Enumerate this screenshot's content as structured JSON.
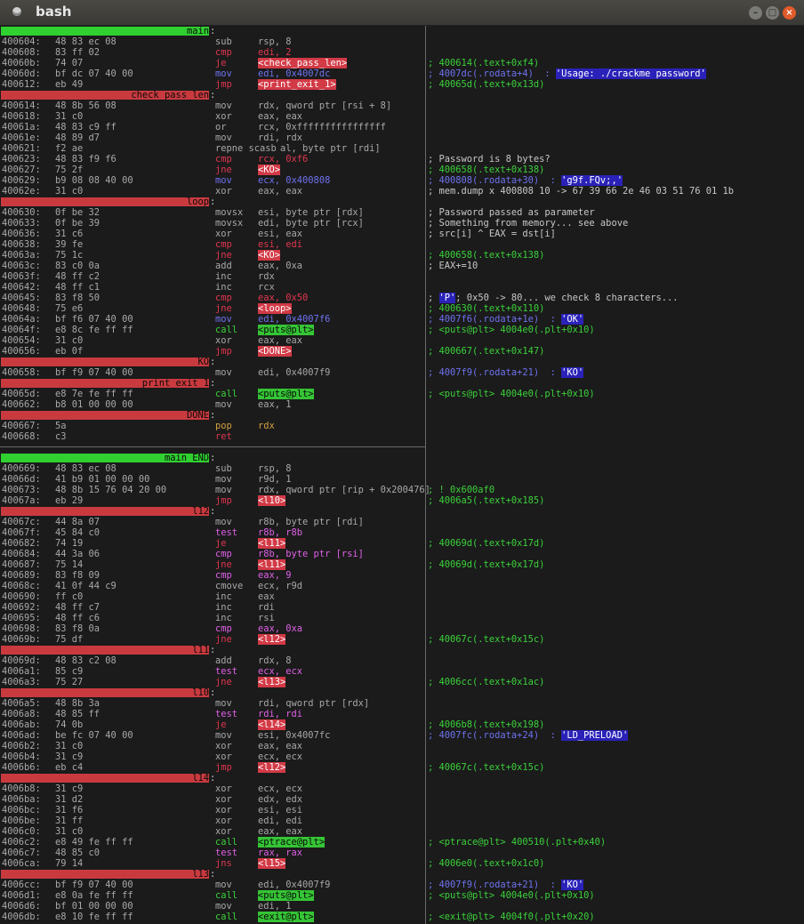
{
  "window": {
    "title": "bash"
  },
  "colors": {
    "label_red": "#c93a3f",
    "label_green": "#2fd030",
    "comment_green": "#3ad13a",
    "string_blue": "#2a22b8"
  },
  "lines": [
    {
      "kind": "label",
      "text": "main",
      "style": "grn"
    },
    {
      "kind": "ins",
      "addr": "400604:",
      "bytes": "48 83 ec 08",
      "mn": "sub",
      "op": "rsp, 8",
      "cm": ""
    },
    {
      "kind": "ins",
      "addr": "400608:",
      "bytes": "83 ff 02",
      "mn": "cmp",
      "op": "edi, 2",
      "mnc": "red",
      "opc": "red",
      "cm": ""
    },
    {
      "kind": "ins",
      "addr": "40060b:",
      "bytes": "74 07",
      "mn": "je",
      "op": "<check_pass_len>",
      "mnc": "red",
      "optag": "red",
      "cm": "; 400614(.text+0xf4)",
      "cmc": "grn"
    },
    {
      "kind": "ins",
      "addr": "40060d:",
      "bytes": "bf dc 07 40 00",
      "mn": "mov",
      "op": "edi, 0x4007dc",
      "mnc": "blu",
      "opc": "blu",
      "cm": "; 4007dc(.rodata+4)  : ",
      "cmc": "blu",
      "cmtag": "'Usage: ./crackme password'"
    },
    {
      "kind": "ins",
      "addr": "400612:",
      "bytes": "eb 49",
      "mn": "jmp",
      "op": "<print_exit_1>",
      "mnc": "red",
      "optag": "red",
      "cm": "; 40065d(.text+0x13d)",
      "cmc": "grn"
    },
    {
      "kind": "label",
      "text": "check_pass_len",
      "style": "red"
    },
    {
      "kind": "ins",
      "addr": "400614:",
      "bytes": "48 8b 56 08",
      "mn": "mov",
      "op": "rdx, qword ptr [rsi + 8]",
      "cm": ""
    },
    {
      "kind": "ins",
      "addr": "400618:",
      "bytes": "31 c0",
      "mn": "xor",
      "op": "eax, eax",
      "cm": ""
    },
    {
      "kind": "ins",
      "addr": "40061a:",
      "bytes": "48 83 c9 ff",
      "mn": "or",
      "op": "rcx, 0xffffffffffffffff",
      "cm": ""
    },
    {
      "kind": "ins",
      "addr": "40061e:",
      "bytes": "48 89 d7",
      "mn": "mov",
      "op": "rdi, rdx",
      "cm": ""
    },
    {
      "kind": "ins",
      "addr": "400621:",
      "bytes": "f2 ae",
      "mn": "repne scasb",
      "op": "    al, byte ptr [rdi]",
      "cm": ""
    },
    {
      "kind": "ins",
      "addr": "400623:",
      "bytes": "48 83 f9 f6",
      "mn": "cmp",
      "op": "rcx, 0xf6",
      "mnc": "red",
      "opc": "red",
      "cm": "; Password is 8 bytes?",
      "cmc": "wht"
    },
    {
      "kind": "ins",
      "addr": "400627:",
      "bytes": "75 2f",
      "mn": "jne",
      "op": "<KO>",
      "mnc": "red",
      "optag": "red",
      "cm": "; 400658(.text+0x138)",
      "cmc": "grn"
    },
    {
      "kind": "ins",
      "addr": "400629:",
      "bytes": "b9 08 08 40 00",
      "mn": "mov",
      "op": "ecx, 0x400808",
      "mnc": "blu",
      "opc": "blu",
      "cm": "; 400808(.rodata+30)  : ",
      "cmc": "blu",
      "cmtag": "'g9f.FQv;,'"
    },
    {
      "kind": "ins",
      "addr": "40062e:",
      "bytes": "31 c0",
      "mn": "xor",
      "op": "eax, eax",
      "cm": "; mem.dump x 400808 10 -> 67 39 66 2e 46 03 51 76 01 1b",
      "cmc": "wht"
    },
    {
      "kind": "label",
      "text": "loop",
      "style": "red"
    },
    {
      "kind": "ins",
      "addr": "400630:",
      "bytes": "0f be 32",
      "mn": "movsx",
      "op": "esi, byte ptr [rdx]",
      "cm": "; Password passed as parameter",
      "cmc": "wht"
    },
    {
      "kind": "ins",
      "addr": "400633:",
      "bytes": "0f be 39",
      "mn": "movsx",
      "op": "edi, byte ptr [rcx]",
      "cm": "; Something from memory... see above",
      "cmc": "wht"
    },
    {
      "kind": "ins",
      "addr": "400636:",
      "bytes": "31 c6",
      "mn": "xor",
      "op": "esi, eax",
      "cm": "; src[i] ^ EAX = dst[i]",
      "cmc": "wht"
    },
    {
      "kind": "ins",
      "addr": "400638:",
      "bytes": "39 fe",
      "mn": "cmp",
      "op": "esi, edi",
      "mnc": "red",
      "opc": "red",
      "cm": ""
    },
    {
      "kind": "ins",
      "addr": "40063a:",
      "bytes": "75 1c",
      "mn": "jne",
      "op": "<KO>",
      "mnc": "red",
      "optag": "red",
      "cm": "; 400658(.text+0x138)",
      "cmc": "grn"
    },
    {
      "kind": "ins",
      "addr": "40063c:",
      "bytes": "83 c0 0a",
      "mn": "add",
      "op": "eax, 0xa",
      "cm": "; EAX+=10",
      "cmc": "wht"
    },
    {
      "kind": "ins",
      "addr": "40063f:",
      "bytes": "48 ff c2",
      "mn": "inc",
      "op": "rdx",
      "cm": ""
    },
    {
      "kind": "ins",
      "addr": "400642:",
      "bytes": "48 ff c1",
      "mn": "inc",
      "op": "rcx",
      "cm": ""
    },
    {
      "kind": "ins",
      "addr": "400645:",
      "bytes": "83 f8 50",
      "mn": "cmp",
      "op": "eax, 0x50",
      "mnc": "red",
      "opc": "red",
      "cm": "; ",
      "cmc": "wht",
      "cmtag2": "'P'",
      "cmrest": "; 0x50 -> 80... we check 8 characters..."
    },
    {
      "kind": "ins",
      "addr": "400648:",
      "bytes": "75 e6",
      "mn": "jne",
      "op": "<loop>",
      "mnc": "red",
      "optag": "red",
      "cm": "; 400630(.text+0x110)",
      "cmc": "grn"
    },
    {
      "kind": "ins",
      "addr": "40064a:",
      "bytes": "bf f6 07 40 00",
      "mn": "mov",
      "op": "edi, 0x4007f6",
      "mnc": "blu",
      "opc": "blu",
      "cm": "; 4007f6(.rodata+1e)  : ",
      "cmc": "blu",
      "cmtag": "'OK'"
    },
    {
      "kind": "ins",
      "addr": "40064f:",
      "bytes": "e8 8c fe ff ff",
      "mn": "call",
      "op": "<puts@plt>",
      "mnc": "grn",
      "optag": "grn",
      "cm": "; <puts@plt> 4004e0(.plt+0x10)",
      "cmc": "grn"
    },
    {
      "kind": "ins",
      "addr": "400654:",
      "bytes": "31 c0",
      "mn": "xor",
      "op": "eax, eax",
      "cm": ""
    },
    {
      "kind": "ins",
      "addr": "400656:",
      "bytes": "eb 0f",
      "mn": "jmp",
      "op": "<DONE>",
      "mnc": "red",
      "optag": "red",
      "cm": "; 400667(.text+0x147)",
      "cmc": "grn"
    },
    {
      "kind": "label",
      "text": "KO",
      "style": "red"
    },
    {
      "kind": "ins",
      "addr": "400658:",
      "bytes": "bf f9 07 40 00",
      "mn": "mov",
      "op": "edi, 0x4007f9",
      "cm": "; 4007f9(.rodata+21)  : ",
      "cmc": "blu",
      "cmtag": "'KO'"
    },
    {
      "kind": "label",
      "text": "print_exit_1",
      "style": "red"
    },
    {
      "kind": "ins",
      "addr": "40065d:",
      "bytes": "e8 7e fe ff ff",
      "mn": "call",
      "op": "<puts@plt>",
      "mnc": "grn",
      "optag": "grn",
      "cm": "; <puts@plt> 4004e0(.plt+0x10)",
      "cmc": "grn"
    },
    {
      "kind": "ins",
      "addr": "400662:",
      "bytes": "b8 01 00 00 00",
      "mn": "mov",
      "op": "eax, 1",
      "cm": ""
    },
    {
      "kind": "label",
      "text": "DONE",
      "style": "red"
    },
    {
      "kind": "ins",
      "addr": "400667:",
      "bytes": "5a",
      "mn": "pop",
      "op": "rdx",
      "mnc": "yel",
      "opc": "yel",
      "cm": ""
    },
    {
      "kind": "ins",
      "addr": "400668:",
      "bytes": "c3",
      "mn": "ret",
      "op": "",
      "mnc": "red",
      "cm": ""
    },
    {
      "kind": "blank"
    },
    {
      "kind": "label",
      "text": "main_END",
      "style": "grn"
    },
    {
      "kind": "ins",
      "addr": "400669:",
      "bytes": "48 83 ec 08",
      "mn": "sub",
      "op": "rsp, 8",
      "cm": ""
    },
    {
      "kind": "ins",
      "addr": "40066d:",
      "bytes": "41 b9 01 00 00 00",
      "mn": "mov",
      "op": "r9d, 1",
      "cm": ""
    },
    {
      "kind": "ins",
      "addr": "400673:",
      "bytes": "48 8b 15 76 04 20 00",
      "mn": "mov",
      "op": "rdx, qword ptr [rip + 0x200476]",
      "cm": "; ! 0x600af0",
      "cmc": "grn"
    },
    {
      "kind": "ins",
      "addr": "40067a:",
      "bytes": "eb 29",
      "mn": "jmp",
      "op": "<l10>",
      "mnc": "red",
      "optag": "red",
      "cm": "; 4006a5(.text+0x185)",
      "cmc": "grn"
    },
    {
      "kind": "label",
      "text": "l12",
      "style": "red"
    },
    {
      "kind": "ins",
      "addr": "40067c:",
      "bytes": "44 8a 07",
      "mn": "mov",
      "op": "r8b, byte ptr [rdi]",
      "cm": ""
    },
    {
      "kind": "ins",
      "addr": "40067f:",
      "bytes": "45 84 c0",
      "mn": "test",
      "op": "r8b, r8b",
      "mnc": "mag",
      "opc": "mag",
      "cm": ""
    },
    {
      "kind": "ins",
      "addr": "400682:",
      "bytes": "74 19",
      "mn": "je",
      "op": "<l11>",
      "mnc": "red",
      "optag": "red",
      "cm": "; 40069d(.text+0x17d)",
      "cmc": "grn"
    },
    {
      "kind": "ins",
      "addr": "400684:",
      "bytes": "44 3a 06",
      "mn": "cmp",
      "op": "r8b, byte ptr [rsi]",
      "mnc": "mag",
      "opc": "mag",
      "cm": ""
    },
    {
      "kind": "ins",
      "addr": "400687:",
      "bytes": "75 14",
      "mn": "jne",
      "op": "<l11>",
      "mnc": "red",
      "optag": "red",
      "cm": "; 40069d(.text+0x17d)",
      "cmc": "grn"
    },
    {
      "kind": "ins",
      "addr": "400689:",
      "bytes": "83 f8 09",
      "mn": "cmp",
      "op": "eax, 9",
      "mnc": "mag",
      "opc": "mag",
      "cm": ""
    },
    {
      "kind": "ins",
      "addr": "40068c:",
      "bytes": "41 0f 44 c9",
      "mn": "cmove",
      "op": "ecx, r9d",
      "cm": ""
    },
    {
      "kind": "ins",
      "addr": "400690:",
      "bytes": "ff c0",
      "mn": "inc",
      "op": "eax",
      "cm": ""
    },
    {
      "kind": "ins",
      "addr": "400692:",
      "bytes": "48 ff c7",
      "mn": "inc",
      "op": "rdi",
      "cm": ""
    },
    {
      "kind": "ins",
      "addr": "400695:",
      "bytes": "48 ff c6",
      "mn": "inc",
      "op": "rsi",
      "cm": ""
    },
    {
      "kind": "ins",
      "addr": "400698:",
      "bytes": "83 f8 0a",
      "mn": "cmp",
      "op": "eax, 0xa",
      "mnc": "mag",
      "opc": "mag",
      "cm": ""
    },
    {
      "kind": "ins",
      "addr": "40069b:",
      "bytes": "75 df",
      "mn": "jne",
      "op": "<l12>",
      "mnc": "red",
      "optag": "red",
      "cm": "; 40067c(.text+0x15c)",
      "cmc": "grn"
    },
    {
      "kind": "label",
      "text": "l11",
      "style": "red"
    },
    {
      "kind": "ins",
      "addr": "40069d:",
      "bytes": "48 83 c2 08",
      "mn": "add",
      "op": "rdx, 8",
      "cm": ""
    },
    {
      "kind": "ins",
      "addr": "4006a1:",
      "bytes": "85 c9",
      "mn": "test",
      "op": "ecx, ecx",
      "mnc": "mag",
      "opc": "mag",
      "cm": ""
    },
    {
      "kind": "ins",
      "addr": "4006a3:",
      "bytes": "75 27",
      "mn": "jne",
      "op": "<l13>",
      "mnc": "red",
      "optag": "red",
      "cm": "; 4006cc(.text+0x1ac)",
      "cmc": "grn"
    },
    {
      "kind": "label",
      "text": "l10",
      "style": "red"
    },
    {
      "kind": "ins",
      "addr": "4006a5:",
      "bytes": "48 8b 3a",
      "mn": "mov",
      "op": "rdi, qword ptr [rdx]",
      "cm": ""
    },
    {
      "kind": "ins",
      "addr": "4006a8:",
      "bytes": "48 85 ff",
      "mn": "test",
      "op": "rdi, rdi",
      "mnc": "mag",
      "opc": "mag",
      "cm": ""
    },
    {
      "kind": "ins",
      "addr": "4006ab:",
      "bytes": "74 0b",
      "mn": "je",
      "op": "<l14>",
      "mnc": "red",
      "optag": "red",
      "cm": "; 4006b8(.text+0x198)",
      "cmc": "grn"
    },
    {
      "kind": "ins",
      "addr": "4006ad:",
      "bytes": "be fc 07 40 00",
      "mn": "mov",
      "op": "esi, 0x4007fc",
      "cm": "; 4007fc(.rodata+24)  : ",
      "cmc": "blu",
      "cmtag": "'LD_PRELOAD'"
    },
    {
      "kind": "ins",
      "addr": "4006b2:",
      "bytes": "31 c0",
      "mn": "xor",
      "op": "eax, eax",
      "cm": ""
    },
    {
      "kind": "ins",
      "addr": "4006b4:",
      "bytes": "31 c9",
      "mn": "xor",
      "op": "ecx, ecx",
      "cm": ""
    },
    {
      "kind": "ins",
      "addr": "4006b6:",
      "bytes": "eb c4",
      "mn": "jmp",
      "op": "<l12>",
      "mnc": "red",
      "optag": "red",
      "cm": "; 40067c(.text+0x15c)",
      "cmc": "grn"
    },
    {
      "kind": "label",
      "text": "l14",
      "style": "red"
    },
    {
      "kind": "ins",
      "addr": "4006b8:",
      "bytes": "31 c9",
      "mn": "xor",
      "op": "ecx, ecx",
      "cm": ""
    },
    {
      "kind": "ins",
      "addr": "4006ba:",
      "bytes": "31 d2",
      "mn": "xor",
      "op": "edx, edx",
      "cm": ""
    },
    {
      "kind": "ins",
      "addr": "4006bc:",
      "bytes": "31 f6",
      "mn": "xor",
      "op": "esi, esi",
      "cm": ""
    },
    {
      "kind": "ins",
      "addr": "4006be:",
      "bytes": "31 ff",
      "mn": "xor",
      "op": "edi, edi",
      "cm": ""
    },
    {
      "kind": "ins",
      "addr": "4006c0:",
      "bytes": "31 c0",
      "mn": "xor",
      "op": "eax, eax",
      "cm": ""
    },
    {
      "kind": "ins",
      "addr": "4006c2:",
      "bytes": "e8 49 fe ff ff",
      "mn": "call",
      "op": "<ptrace@plt>",
      "mnc": "grn",
      "optag": "grn",
      "cm": "; <ptrace@plt> 400510(.plt+0x40)",
      "cmc": "grn"
    },
    {
      "kind": "ins",
      "addr": "4006c7:",
      "bytes": "48 85 c0",
      "mn": "test",
      "op": "rax, rax",
      "mnc": "mag",
      "opc": "mag",
      "cm": ""
    },
    {
      "kind": "ins",
      "addr": "4006ca:",
      "bytes": "79 14",
      "mn": "jns",
      "op": "<l15>",
      "mnc": "red",
      "optag": "red",
      "cm": "; 4006e0(.text+0x1c0)",
      "cmc": "grn"
    },
    {
      "kind": "label",
      "text": "l13",
      "style": "red"
    },
    {
      "kind": "ins",
      "addr": "4006cc:",
      "bytes": "bf f9 07 40 00",
      "mn": "mov",
      "op": "edi, 0x4007f9",
      "cm": "; 4007f9(.rodata+21)  : ",
      "cmc": "blu",
      "cmtag": "'KO'"
    },
    {
      "kind": "ins",
      "addr": "4006d1:",
      "bytes": "e8 0a fe ff ff",
      "mn": "call",
      "op": "<puts@plt>",
      "mnc": "grn",
      "optag": "grn",
      "cm": "; <puts@plt> 4004e0(.plt+0x10)",
      "cmc": "grn"
    },
    {
      "kind": "ins",
      "addr": "4006d6:",
      "bytes": "bf 01 00 00 00",
      "mn": "mov",
      "op": "edi, 1",
      "cm": ""
    },
    {
      "kind": "ins",
      "addr": "4006db:",
      "bytes": "e8 10 fe ff ff",
      "mn": "call",
      "op": "<exit@plt>",
      "mnc": "grn",
      "optag": "grn",
      "cm": "; <exit@plt> 4004f0(.plt+0x20)",
      "cmc": "grn"
    }
  ]
}
